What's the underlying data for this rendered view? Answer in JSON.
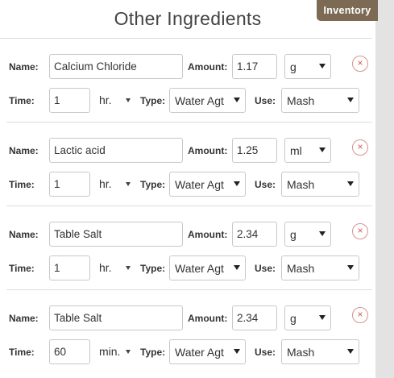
{
  "header": {
    "title": "Other Ingredients",
    "inventory_tab": "Inventory"
  },
  "labels": {
    "name": "Name:",
    "amount": "Amount:",
    "time": "Time:",
    "type": "Type:",
    "use": "Use:"
  },
  "ingredients": [
    {
      "name": "Calcium Chloride",
      "amount": "1.17",
      "amount_unit": "g",
      "time": "1",
      "time_unit": "hr.",
      "type": "Water Agt",
      "use": "Mash"
    },
    {
      "name": "Lactic acid",
      "amount": "1.25",
      "amount_unit": "ml",
      "time": "1",
      "time_unit": "hr.",
      "type": "Water Agt",
      "use": "Mash"
    },
    {
      "name": "Table Salt",
      "amount": "2.34",
      "amount_unit": "g",
      "time": "1",
      "time_unit": "hr.",
      "type": "Water Agt",
      "use": "Mash"
    },
    {
      "name": "Table Salt",
      "amount": "2.34",
      "amount_unit": "g",
      "time": "60",
      "time_unit": "min.",
      "type": "Water Agt",
      "use": "Mash"
    }
  ],
  "icons": {
    "remove": "close-circle-icon",
    "dropdown": "chevron-down-icon"
  },
  "colors": {
    "inventory_tab": "#7c6a54",
    "remove_icon": "#d05850",
    "sidebar": "#e3e3e3"
  },
  "remove_symbol": "×"
}
